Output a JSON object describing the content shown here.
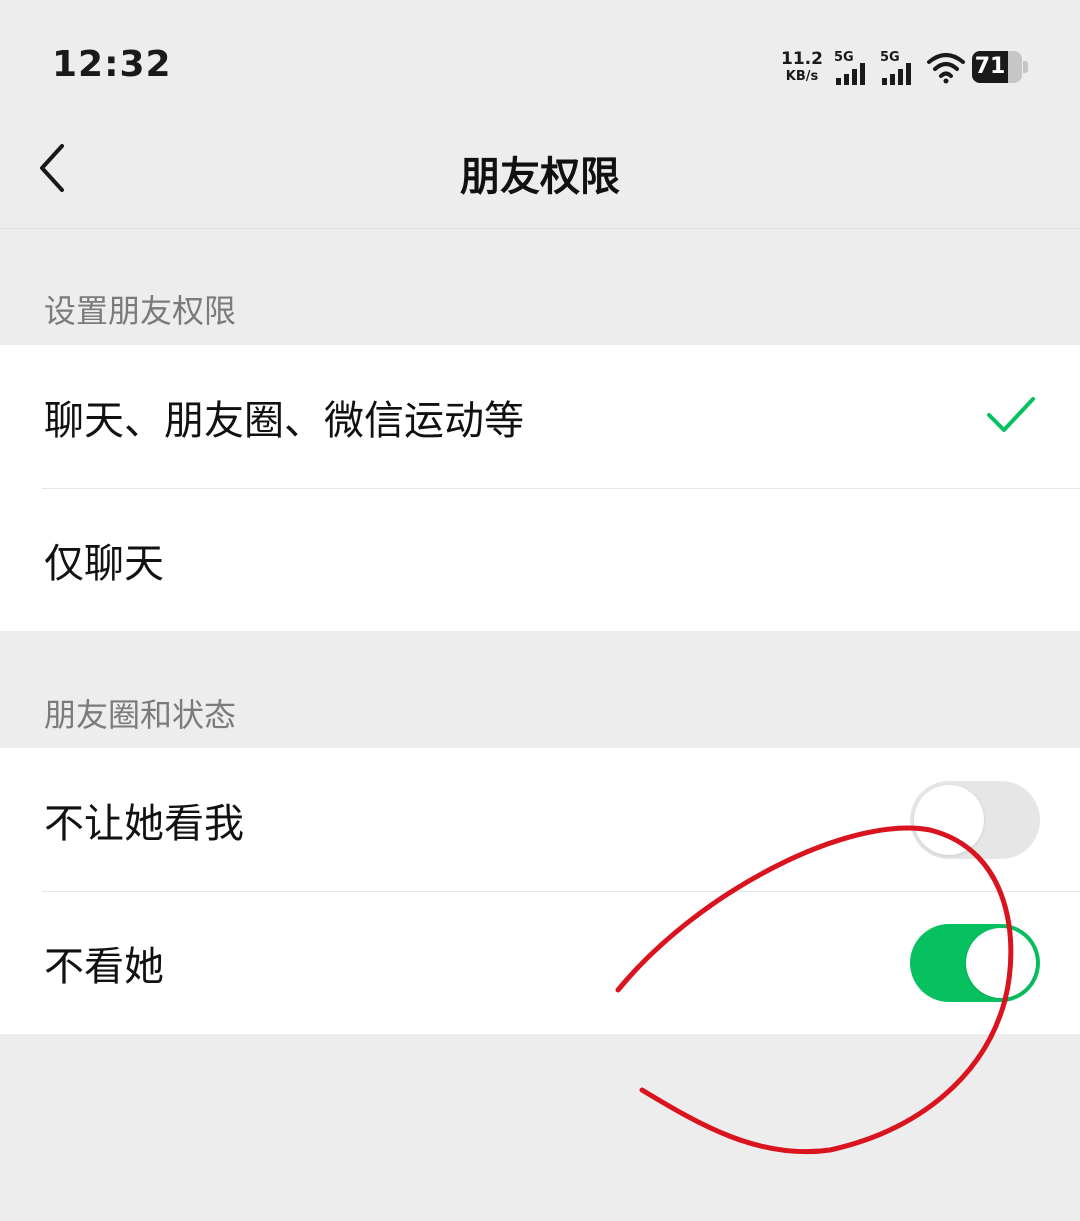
{
  "status_bar": {
    "time": "12:32",
    "net_speed_value": "11.2",
    "net_speed_unit": "KB/s",
    "signal_1_label": "5G",
    "signal_2_label": "5G",
    "battery_level": "71"
  },
  "nav": {
    "title": "朋友权限",
    "back_icon": "chevron-left-icon"
  },
  "sections": {
    "permission_header": "设置朋友权限",
    "permission_options": [
      {
        "label": "聊天、朋友圈、微信运动等",
        "selected": true
      },
      {
        "label": "仅聊天",
        "selected": false
      }
    ],
    "moments_header": "朋友圈和状态",
    "moments_toggles": [
      {
        "label": "不让她看我",
        "enabled": false
      },
      {
        "label": "不看她",
        "enabled": true
      }
    ]
  },
  "colors": {
    "accent_green": "#07c160",
    "annotation_red": "#d9141e",
    "background": "#ededed"
  }
}
